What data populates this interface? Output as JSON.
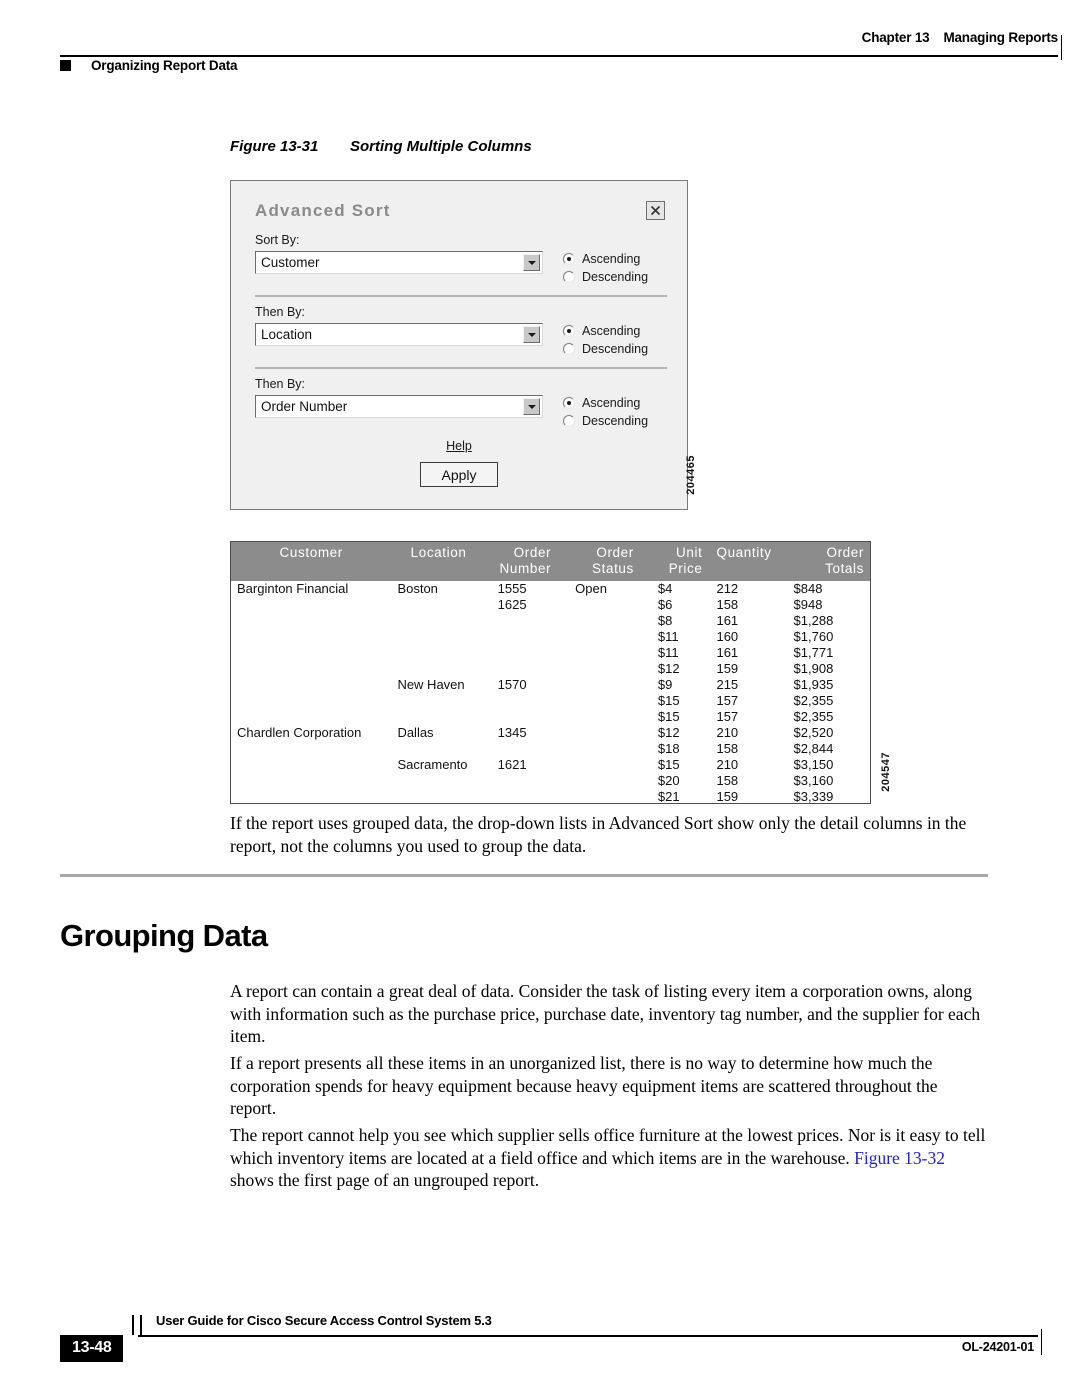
{
  "header": {
    "chapter_number": "Chapter 13",
    "chapter_title": "Managing Reports",
    "section_label": "Organizing Report Data"
  },
  "figure1": {
    "caption_number": "Figure 13-31",
    "caption_title": "Sorting Multiple Columns",
    "figure_id": "204465",
    "dialog": {
      "title": "Advanced Sort",
      "close_label": "☒",
      "blocks": [
        {
          "label": "Sort By:",
          "value": "Customer",
          "ascending_label": "Ascending",
          "descending_label": "Descending",
          "selected": "Ascending"
        },
        {
          "label": "Then By:",
          "value": "Location",
          "ascending_label": "Ascending",
          "descending_label": "Descending",
          "selected": "Ascending"
        },
        {
          "label": "Then By:",
          "value": "Order Number",
          "ascending_label": "Ascending",
          "descending_label": "Descending",
          "selected": "Ascending"
        }
      ],
      "help_label": "Help",
      "apply_label": "Apply"
    }
  },
  "figure2": {
    "figure_id": "204547",
    "columns": [
      "Customer",
      "Location",
      "Order\nNumber",
      "Order\nStatus",
      "Unit\nPrice",
      "Quantity",
      "Order\nTotals"
    ],
    "rows": [
      {
        "customer": "Barginton Financial",
        "location": "Boston",
        "order_number": "1555",
        "order_status": "Open",
        "unit_price": "$4",
        "quantity": "212",
        "order_totals": "$848"
      },
      {
        "customer": "",
        "location": "",
        "order_number": "1625",
        "order_status": "",
        "unit_price": "$6",
        "quantity": "158",
        "order_totals": "$948"
      },
      {
        "customer": "",
        "location": "",
        "order_number": "",
        "order_status": "",
        "unit_price": "$8",
        "quantity": "161",
        "order_totals": "$1,288"
      },
      {
        "customer": "",
        "location": "",
        "order_number": "",
        "order_status": "",
        "unit_price": "$11",
        "quantity": "160",
        "order_totals": "$1,760"
      },
      {
        "customer": "",
        "location": "",
        "order_number": "",
        "order_status": "",
        "unit_price": "$11",
        "quantity": "161",
        "order_totals": "$1,771"
      },
      {
        "customer": "",
        "location": "",
        "order_number": "",
        "order_status": "",
        "unit_price": "$12",
        "quantity": "159",
        "order_totals": "$1,908"
      },
      {
        "customer": "",
        "location": "New Haven",
        "order_number": "1570",
        "order_status": "",
        "unit_price": "$9",
        "quantity": "215",
        "order_totals": "$1,935"
      },
      {
        "customer": "",
        "location": "",
        "order_number": "",
        "order_status": "",
        "unit_price": "$15",
        "quantity": "157",
        "order_totals": "$2,355"
      },
      {
        "customer": "",
        "location": "",
        "order_number": "",
        "order_status": "",
        "unit_price": "$15",
        "quantity": "157",
        "order_totals": "$2,355"
      },
      {
        "customer": "Chardlen Corporation",
        "location": "Dallas",
        "order_number": "1345",
        "order_status": "",
        "unit_price": "$12",
        "quantity": "210",
        "order_totals": "$2,520"
      },
      {
        "customer": "",
        "location": "",
        "order_number": "",
        "order_status": "",
        "unit_price": "$18",
        "quantity": "158",
        "order_totals": "$2,844"
      },
      {
        "customer": "",
        "location": "Sacramento",
        "order_number": "1621",
        "order_status": "",
        "unit_price": "$15",
        "quantity": "210",
        "order_totals": "$3,150"
      },
      {
        "customer": "",
        "location": "",
        "order_number": "",
        "order_status": "",
        "unit_price": "$20",
        "quantity": "158",
        "order_totals": "$3,160"
      },
      {
        "customer": "",
        "location": "",
        "order_number": "",
        "order_status": "",
        "unit_price": "$21",
        "quantity": "159",
        "order_totals": "$3,339"
      }
    ]
  },
  "body": {
    "paragraph_after_figure": "If the report uses grouped data, the drop-down lists in Advanced Sort show only the detail columns in the report, not the columns you used to group the data.",
    "section_title": "Grouping Data",
    "paragraph_1": "A report can contain a great deal of data. Consider the task of listing every item a corporation owns, along with information such as the purchase price, purchase date, inventory tag number, and the supplier for each item.",
    "paragraph_2": "If a report presents all these items in an unorganized list, there is no way to determine how much the corporation spends for heavy equipment because heavy equipment items are scattered throughout the report.",
    "paragraph_3_part1": "The report cannot help you see which supplier sells office furniture at the lowest prices. Nor is it easy to tell which inventory items are located at a field office and which items are in the warehouse. ",
    "paragraph_3_link": "Figure 13-32",
    "paragraph_3_part2": " shows the first page of an ungrouped report."
  },
  "footer": {
    "guide_title": "User Guide for Cisco Secure Access Control System 5.3",
    "page_number": "13-48",
    "document_id": "OL-24201-01"
  }
}
